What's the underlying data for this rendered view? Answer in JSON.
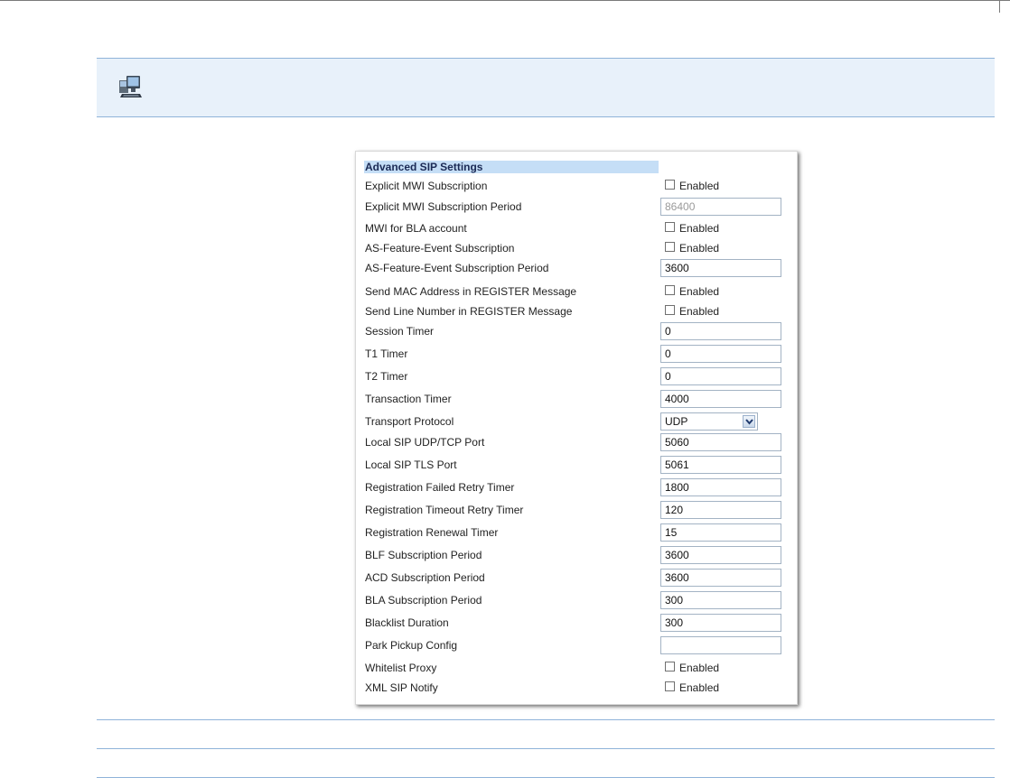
{
  "panel": {
    "title": "Advanced SIP Settings",
    "rows": [
      {
        "label": "Explicit MWI Subscription",
        "type": "checkbox",
        "checkbox_label": "Enabled",
        "checked": false
      },
      {
        "label": "Explicit MWI Subscription Period",
        "type": "text",
        "value": "86400",
        "disabled": true
      },
      {
        "label": "MWI for BLA account",
        "type": "checkbox",
        "checkbox_label": "Enabled",
        "checked": false
      },
      {
        "label": "AS-Feature-Event Subscription",
        "type": "checkbox",
        "checkbox_label": "Enabled",
        "checked": false
      },
      {
        "label": "AS-Feature-Event Subscription Period",
        "type": "text",
        "value": "3600"
      },
      {
        "label": "Send MAC Address in REGISTER Message",
        "type": "checkbox",
        "checkbox_label": "Enabled",
        "checked": false
      },
      {
        "label": "Send Line Number in REGISTER Message",
        "type": "checkbox",
        "checkbox_label": "Enabled",
        "checked": false
      },
      {
        "label": "Session Timer",
        "type": "text",
        "value": "0"
      },
      {
        "label": "T1 Timer",
        "type": "text",
        "value": "0"
      },
      {
        "label": "T2 Timer",
        "type": "text",
        "value": "0"
      },
      {
        "label": "Transaction Timer",
        "type": "text",
        "value": "4000"
      },
      {
        "label": "Transport Protocol",
        "type": "select",
        "value": "UDP"
      },
      {
        "label": "Local SIP UDP/TCP Port",
        "type": "text",
        "value": "5060"
      },
      {
        "label": "Local SIP TLS Port",
        "type": "text",
        "value": "5061"
      },
      {
        "label": "Registration Failed Retry Timer",
        "type": "text",
        "value": "1800"
      },
      {
        "label": "Registration Timeout Retry Timer",
        "type": "text",
        "value": "120"
      },
      {
        "label": "Registration Renewal Timer",
        "type": "text",
        "value": "15"
      },
      {
        "label": "BLF Subscription Period",
        "type": "text",
        "value": "3600"
      },
      {
        "label": "ACD Subscription Period",
        "type": "text",
        "value": "3600"
      },
      {
        "label": "BLA Subscription Period",
        "type": "text",
        "value": "300"
      },
      {
        "label": "Blacklist Duration",
        "type": "text",
        "value": "300"
      },
      {
        "label": "Park Pickup Config",
        "type": "text",
        "value": ""
      },
      {
        "label": "Whitelist Proxy",
        "type": "checkbox",
        "checkbox_label": "Enabled",
        "checked": false
      },
      {
        "label": "XML SIP Notify",
        "type": "checkbox",
        "checkbox_label": "Enabled",
        "checked": false
      }
    ]
  },
  "icons": {
    "banner": "web-ui-computer-icon",
    "select_arrow": "chevron-down-icon"
  },
  "colors": {
    "banner_bg": "#e8f1fa",
    "rule": "#8fb3d9",
    "section_title_bg": "#c5def6",
    "section_title_text": "#1b2a55"
  }
}
